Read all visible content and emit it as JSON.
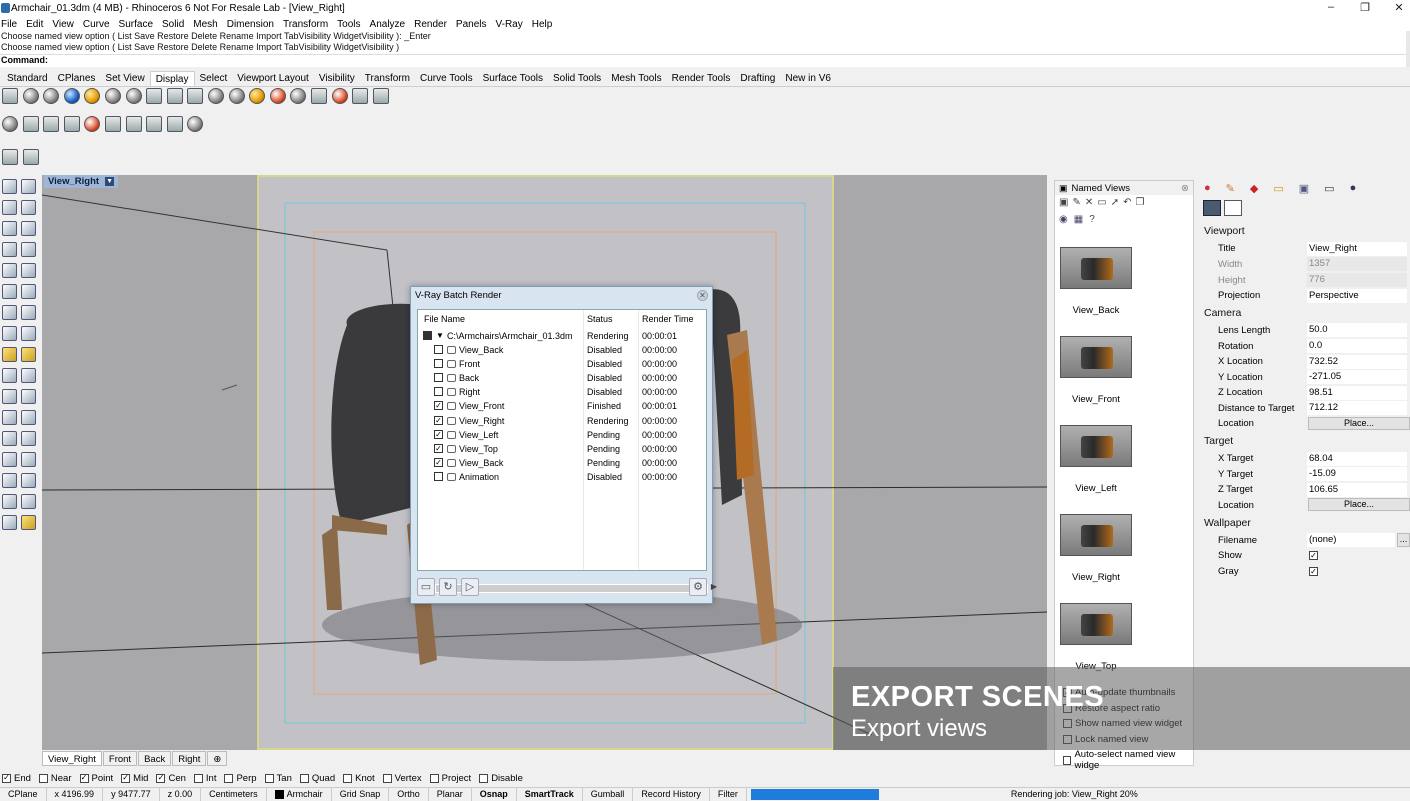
{
  "window": {
    "title": "Armchair_01.3dm (4 MB) - Rhinoceros 6 Not For Resale Lab - [View_Right]",
    "minimize": "–",
    "maximize": "❐",
    "close": "✕"
  },
  "menu": [
    "File",
    "Edit",
    "View",
    "Curve",
    "Surface",
    "Solid",
    "Mesh",
    "Dimension",
    "Transform",
    "Tools",
    "Analyze",
    "Render",
    "Panels",
    "V-Ray",
    "Help"
  ],
  "command": {
    "history1": "Choose named view option ( List  Save  Restore  Delete  Rename  Import  TabVisibility  WidgetVisibility ): _Enter",
    "history2": "Choose named view option ( List  Save  Restore  Delete  Rename  Import  TabVisibility  WidgetVisibility )",
    "prompt": "Command:"
  },
  "toolbar_tabs": [
    "Standard",
    "CPlanes",
    "Set View",
    "Display",
    "Select",
    "Viewport Layout",
    "Visibility",
    "Transform",
    "Curve Tools",
    "Surface Tools",
    "Solid Tools",
    "Mesh Tools",
    "Render Tools",
    "Drafting",
    "New in V6"
  ],
  "active_tab": "Display",
  "viewport": {
    "label": "View_Right",
    "tabs": [
      "View_Right",
      "Front",
      "Back",
      "Right"
    ],
    "add_tab": "⊕"
  },
  "batch_render": {
    "title": "V-Ray Batch Render",
    "columns": [
      "File Name",
      "Status",
      "Render Time"
    ],
    "file": {
      "name": "C:\\Armchairs\\Armchair_01.3dm",
      "status": "Rendering",
      "time": "00:00:01"
    },
    "rows": [
      {
        "name": "View_Back",
        "status": "Disabled",
        "time": "00:00:00",
        "checked": false,
        "icon": "eye"
      },
      {
        "name": "Front",
        "status": "Disabled",
        "time": "00:00:00",
        "checked": false,
        "icon": "eye"
      },
      {
        "name": "Back",
        "status": "Disabled",
        "time": "00:00:00",
        "checked": false,
        "icon": "eye"
      },
      {
        "name": "Right",
        "status": "Disabled",
        "time": "00:00:00",
        "checked": false,
        "icon": "eye"
      },
      {
        "name": "View_Front",
        "status": "Finished",
        "time": "00:00:01",
        "checked": true,
        "icon": "camera"
      },
      {
        "name": "View_Right",
        "status": "Rendering",
        "time": "00:00:00",
        "checked": true,
        "icon": "camera"
      },
      {
        "name": "View_Left",
        "status": "Pending",
        "time": "00:00:00",
        "checked": true,
        "icon": "camera"
      },
      {
        "name": "View_Top",
        "status": "Pending",
        "time": "00:00:00",
        "checked": true,
        "icon": "camera"
      },
      {
        "name": "View_Back",
        "status": "Pending",
        "time": "00:00:00",
        "checked": true,
        "icon": "camera"
      },
      {
        "name": "Animation",
        "status": "Disabled",
        "time": "00:00:00",
        "checked": false,
        "icon": "film"
      }
    ]
  },
  "named_views": {
    "title": "Named Views",
    "items": [
      "View_Back",
      "View_Front",
      "View_Left",
      "View_Right",
      "View_Top"
    ],
    "options": [
      {
        "label": "Auto-update thumbnails",
        "checked": true
      },
      {
        "label": "Restore aspect ratio",
        "checked": false
      },
      {
        "label": "Show named view widget",
        "checked": false
      },
      {
        "label": "Lock named view",
        "checked": false
      },
      {
        "label": "Auto-select named view widge",
        "checked": false
      }
    ]
  },
  "properties": {
    "viewport_header": "Viewport",
    "title_label": "Title",
    "title_value": "View_Right",
    "width_label": "Width",
    "width_value": "1357",
    "height_label": "Height",
    "height_value": "776",
    "projection_label": "Projection",
    "projection_value": "Perspective",
    "camera_header": "Camera",
    "lens_label": "Lens Length",
    "lens_value": "50.0",
    "rotation_label": "Rotation",
    "rotation_value": "0.0",
    "xloc_label": "X Location",
    "xloc_value": "732.52",
    "yloc_label": "Y Location",
    "yloc_value": "-271.05",
    "zloc_label": "Z Location",
    "zloc_value": "98.51",
    "dist_label": "Distance to Target",
    "dist_value": "712.12",
    "loc_label": "Location",
    "place_label": "Place...",
    "target_header": "Target",
    "xt_label": "X Target",
    "xt_value": "68.04",
    "yt_label": "Y Target",
    "yt_value": "-15.09",
    "zt_label": "Z Target",
    "zt_value": "106.65",
    "tloc_label": "Location",
    "wallpaper_header": "Wallpaper",
    "filename_label": "Filename",
    "filename_value": "(none)",
    "browse": "...",
    "show_label": "Show",
    "gray_label": "Gray"
  },
  "osnap": [
    {
      "label": "End",
      "checked": true
    },
    {
      "label": "Near",
      "checked": false
    },
    {
      "label": "Point",
      "checked": true
    },
    {
      "label": "Mid",
      "checked": true
    },
    {
      "label": "Cen",
      "checked": true
    },
    {
      "label": "Int",
      "checked": false
    },
    {
      "label": "Perp",
      "checked": false
    },
    {
      "label": "Tan",
      "checked": false
    },
    {
      "label": "Quad",
      "checked": false
    },
    {
      "label": "Knot",
      "checked": false
    },
    {
      "label": "Vertex",
      "checked": false
    },
    {
      "label": "Project",
      "checked": false
    },
    {
      "label": "Disable",
      "checked": false
    }
  ],
  "status": {
    "cplane": "CPlane",
    "x": "x 4196.99",
    "y": "y 9477.77",
    "z": "z 0.00",
    "units": "Centimeters",
    "layer": "Armchair",
    "toggles": [
      "Grid Snap",
      "Ortho",
      "Planar",
      "Osnap",
      "SmartTrack",
      "Gumball",
      "Record History",
      "Filter"
    ],
    "bold_toggles": [
      "Osnap",
      "SmartTrack"
    ],
    "progress": 0.2,
    "job": "Rendering job: View_Right 20%"
  },
  "overlay": {
    "heading": "EXPORT SCENES",
    "sub": "Export views"
  },
  "colors": {
    "accent": "#1e7ddc",
    "vp_bg": "#a8a7a9",
    "dialog_bg": "#d9e4f1"
  }
}
